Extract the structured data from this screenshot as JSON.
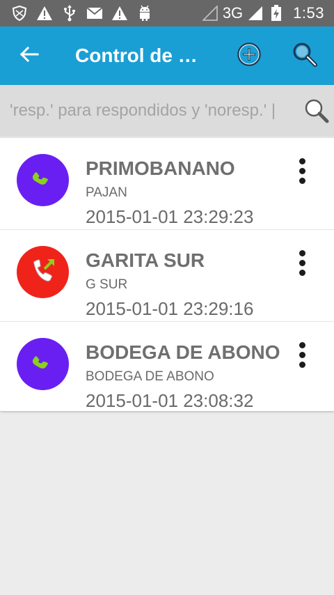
{
  "status_bar": {
    "network": "3G",
    "time": "1:53"
  },
  "app_bar": {
    "title": "Control de R..."
  },
  "search": {
    "placeholder": "'resp.' para respondidos y 'noresp.' |"
  },
  "calls": [
    {
      "name": "PRIMOBANANO",
      "location": "PAJAN",
      "datetime": "2015-01-01 23:29:23",
      "type": "answered",
      "color": "#6a1ff2"
    },
    {
      "name": "GARITA SUR",
      "location": "G SUR",
      "datetime": "2015-01-01 23:29:16",
      "type": "outgoing",
      "color": "#f0231b"
    },
    {
      "name": "BODEGA DE ABONO",
      "location": "BODEGA DE ABONO",
      "datetime": "2015-01-01 23:08:32",
      "type": "answered",
      "color": "#6a1ff2"
    }
  ],
  "colors": {
    "status_bar": "#676767",
    "app_bar": "#1a9fd4",
    "search_bar": "#dcdcdc",
    "background": "#ececec",
    "phone_green": "#8bd11a"
  },
  "icons": {
    "status": [
      "shield-icon",
      "warning-icon",
      "usb-icon",
      "mail-icon",
      "warning-icon",
      "android-icon",
      "signal-icon",
      "battery-icon"
    ],
    "app_bar": [
      "back-arrow-icon",
      "add-circle-icon",
      "search-icon"
    ],
    "rows": [
      "phone-answered-icon",
      "phone-outgoing-icon",
      "more-vert-icon"
    ]
  }
}
